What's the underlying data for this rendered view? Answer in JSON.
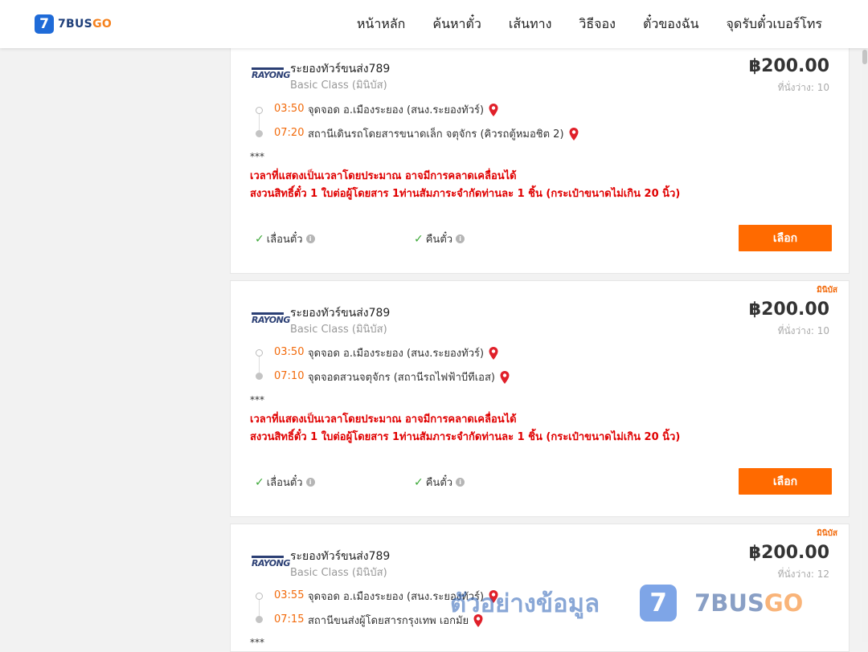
{
  "header": {
    "logo_badge": "7",
    "logo_text_1": "7BUS",
    "logo_text_2": "GO",
    "nav": [
      "หน้าหลัก",
      "ค้นหาตั๋ว",
      "เส้นทาง",
      "วิธีจอง",
      "ตั๋วของฉัน",
      "จุดรับตั๋วเบอร์โทร"
    ]
  },
  "colors": {
    "accent": "#ff6a00",
    "time": "#f26a0b",
    "notice": "#e00000",
    "check": "#3aa735",
    "brand_blue": "#1f6bd8"
  },
  "cards": [
    {
      "badge": "",
      "company_logo_text": "RAYONG",
      "company": "ระยองทัวร์ขนส่ง789",
      "bus_class": "Basic Class (มินิบัส)",
      "price": "฿200.00",
      "seats": "ที่นั่งว่าง: 10",
      "departure_time": "03:50",
      "departure_stop": "จุดจอด อ.เมืองระยอง (สนง.ระยองทัวร์)",
      "arrival_time": "07:20",
      "arrival_stop": "สถานีเดินรถโดยสารขนาดเล็ก จตุจักร (คิวรถตู้หมอชิต 2)",
      "stars": "***",
      "notice_1": "เวลาที่แสดงเป็นเวลาโดยประมาณ อาจมีการคลาดเคลื่อนได้",
      "notice_2": "สงวนสิทธิ์ตั๋ว 1 ใบต่อผู้โดยสาร 1ท่านสัมภาระจำกัดท่านละ 1 ชิ้น (กระเป๋าขนาดไม่เกิน 20 นิ้ว)",
      "feature_1": "เลื่อนตั๋ว",
      "feature_2": "คืนตั๋ว",
      "button": "เลือก"
    },
    {
      "badge": "มินิบัส",
      "company_logo_text": "RAYONG",
      "company": "ระยองทัวร์ขนส่ง789",
      "bus_class": "Basic Class (มินิบัส)",
      "price": "฿200.00",
      "seats": "ที่นั่งว่าง: 10",
      "departure_time": "03:50",
      "departure_stop": "จุดจอด อ.เมืองระยอง (สนง.ระยองทัวร์)",
      "arrival_time": "07:10",
      "arrival_stop": "จุดจอดสวนจตุจักร (สถานีรถไฟฟ้าบีทีเอส)",
      "stars": "***",
      "notice_1": "เวลาที่แสดงเป็นเวลาโดยประมาณ อาจมีการคลาดเคลื่อนได้",
      "notice_2": "สงวนสิทธิ์ตั๋ว 1 ใบต่อผู้โดยสาร 1ท่านสัมภาระจำกัดท่านละ 1 ชิ้น (กระเป๋าขนาดไม่เกิน 20 นิ้ว)",
      "feature_1": "เลื่อนตั๋ว",
      "feature_2": "คืนตั๋ว",
      "button": "เลือก"
    },
    {
      "badge": "มินิบัส",
      "company_logo_text": "RAYONG",
      "company": "ระยองทัวร์ขนส่ง789",
      "bus_class": "Basic Class (มินิบัส)",
      "price": "฿200.00",
      "seats": "ที่นั่งว่าง: 12",
      "departure_time": "03:55",
      "departure_stop": "จุดจอด อ.เมืองระยอง (สนง.ระยองทัวร์)",
      "arrival_time": "07:15",
      "arrival_stop": "สถานีขนส่งผู้โดยสารกรุงเทพ เอกมัย",
      "stars": "***"
    }
  ],
  "watermark": {
    "text": "ตัวอย่างข้อมูล",
    "badge": "7",
    "brand_1": "7BUS",
    "brand_2": "GO"
  }
}
